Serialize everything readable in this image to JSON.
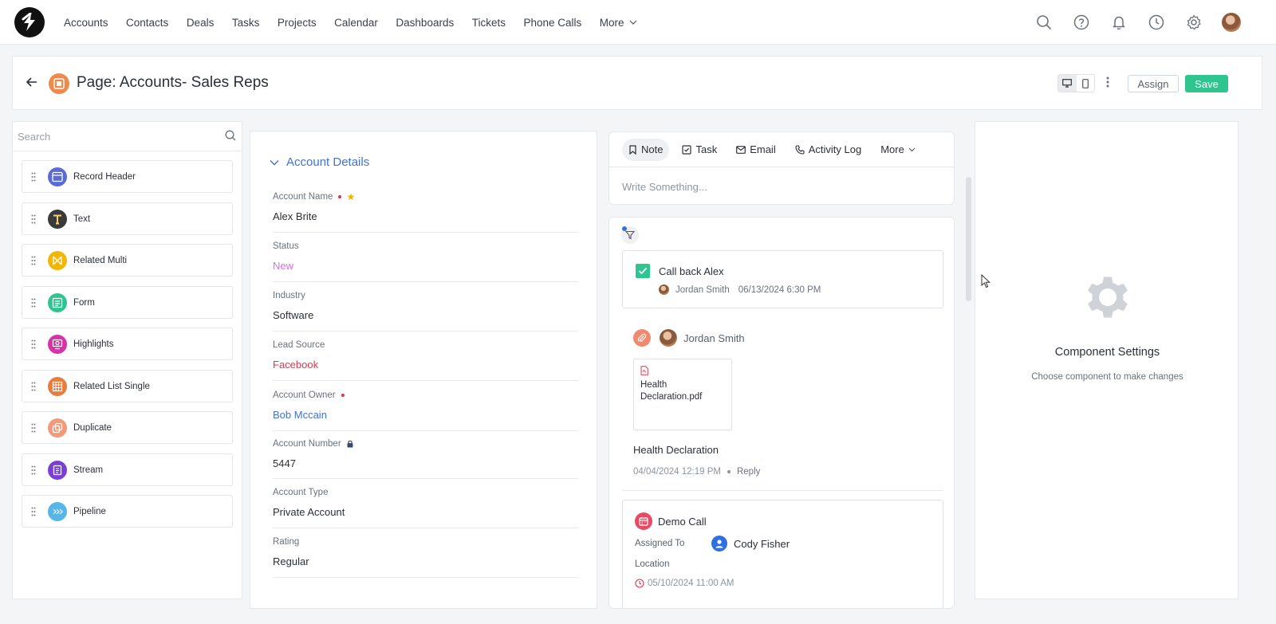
{
  "nav": {
    "links": [
      "Accounts",
      "Contacts",
      "Deals",
      "Tasks",
      "Projects",
      "Calendar",
      "Dashboards",
      "Tickets",
      "Phone Calls"
    ],
    "more_label": "More",
    "icons": [
      "search-icon",
      "help-icon",
      "bell-icon",
      "clock-icon",
      "gear-icon"
    ]
  },
  "header": {
    "title": "Page: Accounts- Sales Reps",
    "assign_label": "Assign",
    "save_label": "Save"
  },
  "sidebar": {
    "search_placeholder": "Search",
    "components": [
      {
        "label": "Record Header",
        "icon": "record-header-icon",
        "color": "#5b6bd6"
      },
      {
        "label": "Text",
        "icon": "text-icon",
        "color": "#3a3a3a"
      },
      {
        "label": "Related Multi",
        "icon": "related-multi-icon",
        "color": "#f2b705"
      },
      {
        "label": "Form",
        "icon": "form-icon",
        "color": "#2ec58f"
      },
      {
        "label": "Highlights",
        "icon": "highlights-icon",
        "color": "#d633a5"
      },
      {
        "label": "Related List Single",
        "icon": "related-list-icon",
        "color": "#e87c3e"
      },
      {
        "label": "Duplicate",
        "icon": "duplicate-icon",
        "color": "#f29a7a"
      },
      {
        "label": "Stream",
        "icon": "stream-icon",
        "color": "#7b3fd6"
      },
      {
        "label": "Pipeline",
        "icon": "pipeline-icon",
        "color": "#56b6e8"
      }
    ]
  },
  "form": {
    "section_title": "Account Details",
    "fields": [
      {
        "label": "Account Name",
        "value": "Alex Brite",
        "value_color": "#2b2f36"
      },
      {
        "label": "Status",
        "value": "New",
        "value_color": "#d56ee8"
      },
      {
        "label": "Industry",
        "value": "Software",
        "value_color": "#2b2f36"
      },
      {
        "label": "Lead Source",
        "value": "Facebook",
        "value_color": "#e0354b"
      },
      {
        "label": "Account Owner",
        "value": "Bob Mccain",
        "value_color": "#3f73d6"
      },
      {
        "label": "Account Number",
        "value": "5447",
        "value_color": "#2b2f36"
      },
      {
        "label": "Account Type",
        "value": "Private Account",
        "value_color": "#2b2f36"
      },
      {
        "label": "Rating",
        "value": "Regular",
        "value_color": "#2b2f36"
      }
    ]
  },
  "activity": {
    "tabs": [
      "Note",
      "Task",
      "Email",
      "Activity Log"
    ],
    "more_label": "More",
    "composer_placeholder": "Write Something...",
    "task": {
      "title": "Call back Alex",
      "user": "Jordan Smith",
      "datetime": "06/13/2024 6:30 PM"
    },
    "note": {
      "user": "Jordan Smith",
      "attachment": "Health Declaration.pdf",
      "title": "Health Declaration",
      "datetime": "04/04/2024 12:19 PM",
      "reply_label": "Reply"
    },
    "call": {
      "title": "Demo Call",
      "assigned_label": "Assigned To",
      "assignee": "Cody Fisher",
      "location_label": "Location",
      "datetime": "05/10/2024 11:00 AM"
    }
  },
  "settings": {
    "title": "Component Settings",
    "subtitle": "Choose component to make changes"
  }
}
